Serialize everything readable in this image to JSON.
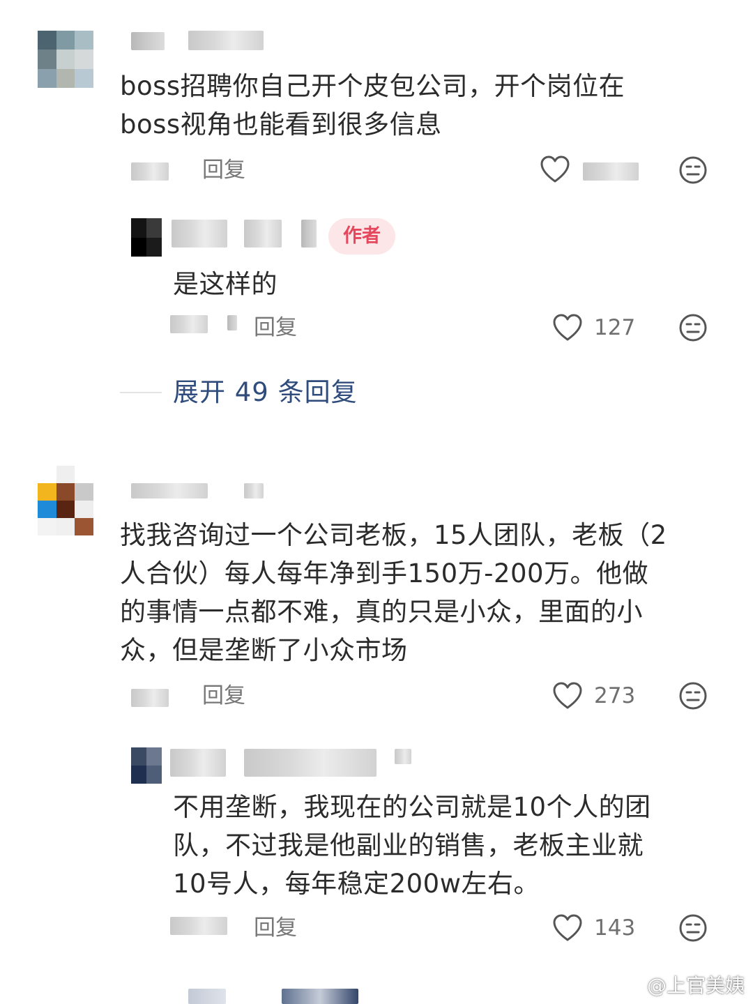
{
  "comments": [
    {
      "text": "boss招聘你自己开个皮包公司，开个岗位在\nboss视角也能看到很多信息",
      "reply_label": "回复",
      "likes": "",
      "replies": [
        {
          "badge": "作者",
          "text": "是这样的",
          "reply_label": "回复",
          "likes": "127"
        }
      ],
      "expand_label": "展开 49 条回复"
    },
    {
      "text": "找我咨询过一个公司老板，15人团队，老板（2\n人合伙）每人每年净到手150万-200万。他做\n的事情一点都不难，真的只是小众，里面的小\n众，但是垄断了小众市场",
      "reply_label": "回复",
      "likes": "273",
      "replies": [
        {
          "text": "不用垄断，我现在的公司就是10个人的团\n队，不过我是他副业的销售，老板主业就\n10号人，每年稳定200w左右。",
          "reply_label": "回复",
          "likes": "143"
        }
      ]
    }
  ],
  "icons": {
    "like": "heart-outline-icon",
    "emoji": "neutral-face-icon",
    "weibo": "weibo-logo-icon"
  },
  "colors": {
    "text": "#2b2b2b",
    "muted": "#777777",
    "link": "#2f4c7c",
    "badge_bg": "#fde6e8",
    "badge_text": "#e5475c"
  },
  "watermark": "@上官美姨"
}
